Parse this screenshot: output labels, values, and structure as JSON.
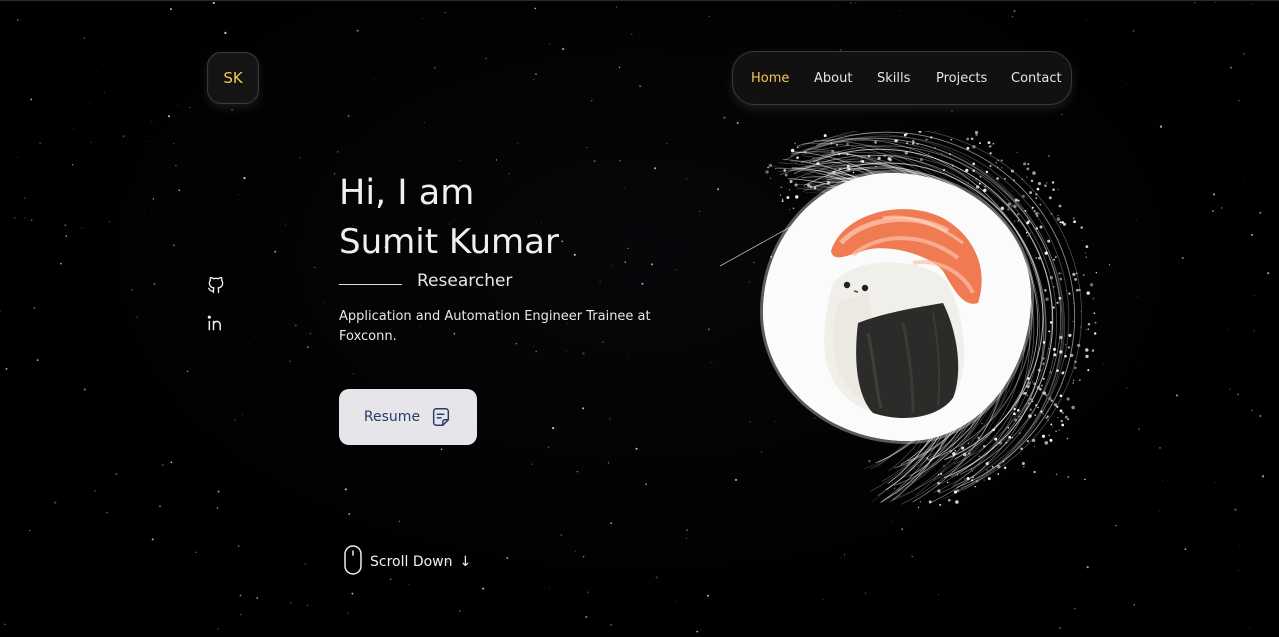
{
  "logo": {
    "text": "SK"
  },
  "nav": {
    "items": [
      {
        "label": "Home",
        "active": true
      },
      {
        "label": "About",
        "active": false
      },
      {
        "label": "Skills",
        "active": false
      },
      {
        "label": "Projects",
        "active": false
      },
      {
        "label": "Contact",
        "active": false
      }
    ]
  },
  "social": [
    {
      "icon": "github-icon"
    },
    {
      "icon": "linkedin-icon"
    }
  ],
  "hero": {
    "greeting": "Hi, I am",
    "name": "Sumit Kumar",
    "role": "Researcher",
    "description": "Application and Automation Engineer Trainee at Foxconn."
  },
  "resume": {
    "label": "Resume",
    "icon": "document-icon"
  },
  "scroll": {
    "label": "Scroll Down",
    "icon": "mouse-icon",
    "arrow": "↓"
  },
  "colors": {
    "accent": "#f5c84c",
    "background": "#000000",
    "button_bg": "#e6e6ea",
    "button_text": "#2b3a6b"
  }
}
